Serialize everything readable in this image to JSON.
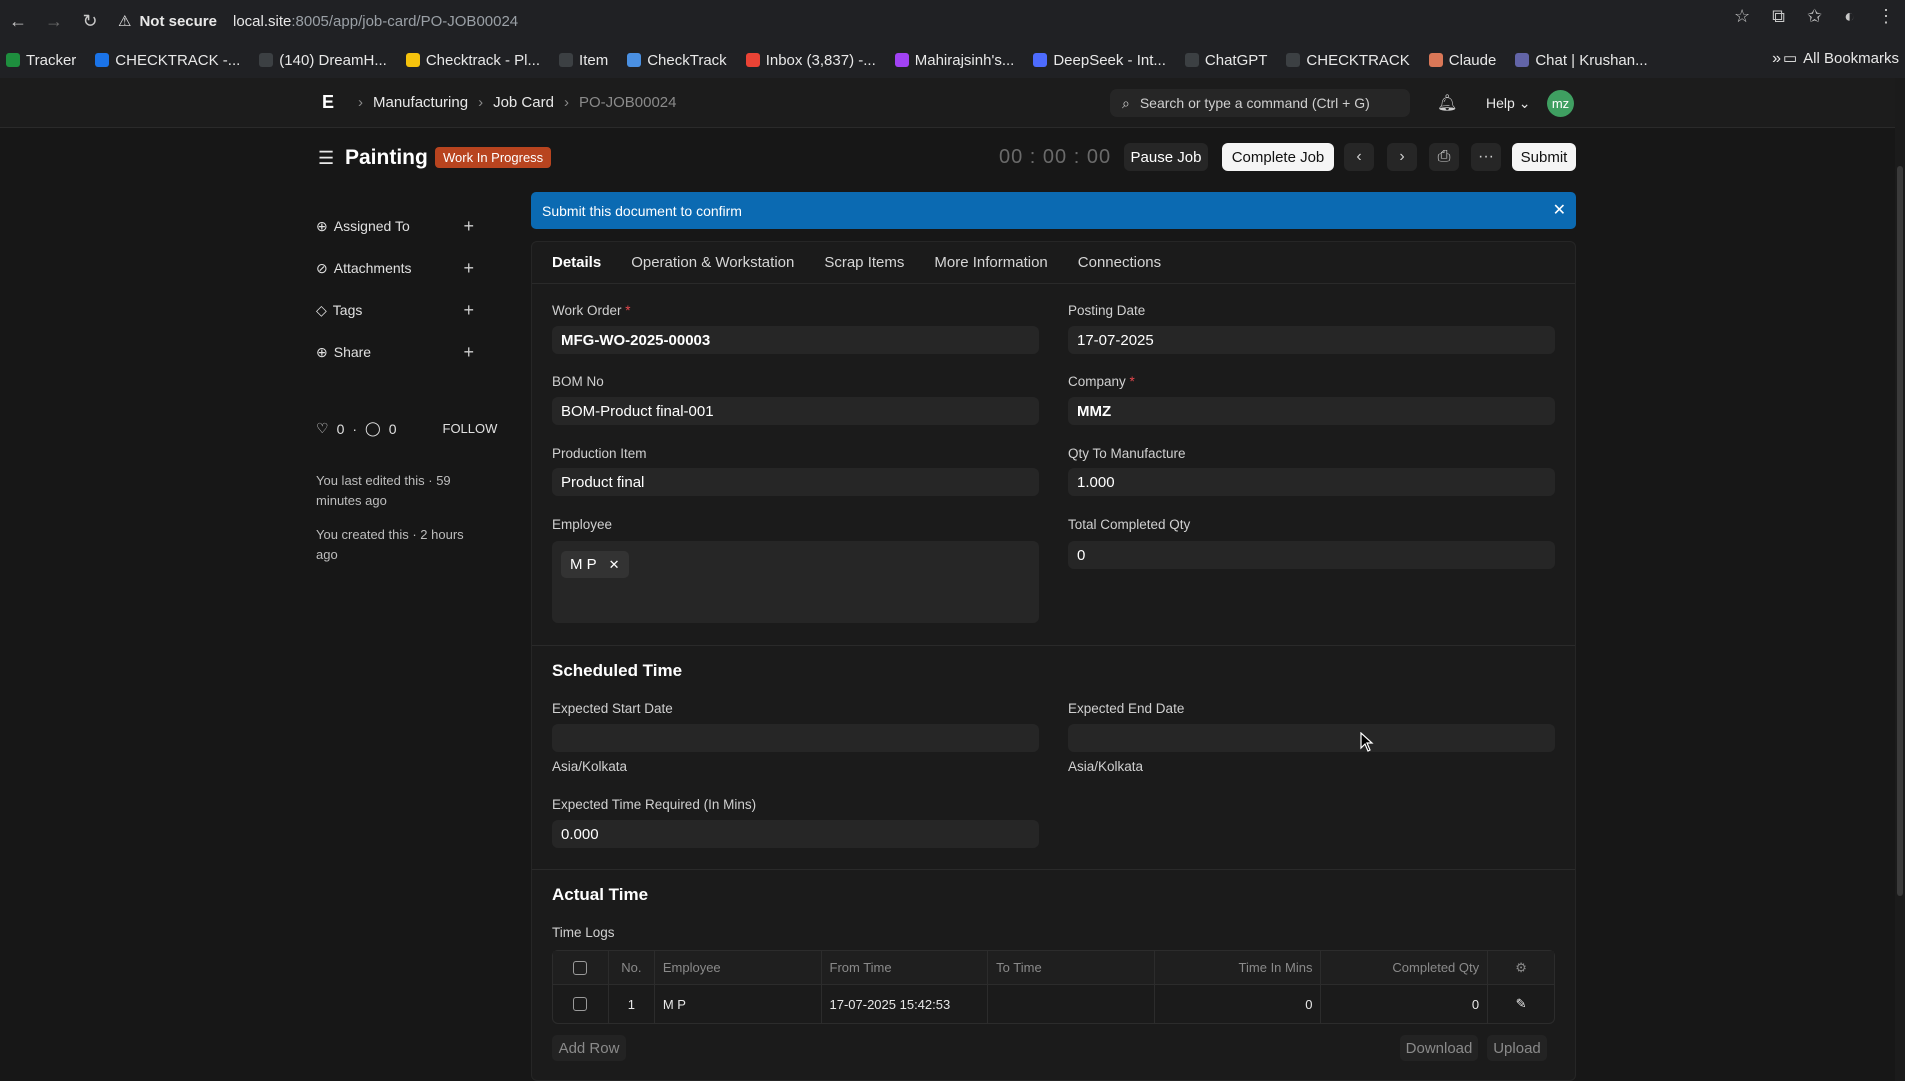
{
  "browser": {
    "warning": "Not secure",
    "url_host": "local.site",
    "url_path": ":8005/app/job-card/PO-JOB00024",
    "bookmarks": [
      {
        "label": "Tracker",
        "color": "#1e8e3e"
      },
      {
        "label": "CHECKTRACK -...",
        "color": "#1a73e8"
      },
      {
        "label": "(140) DreamH...",
        "color": "#3c4043"
      },
      {
        "label": "Checktrack - Pl...",
        "color": "#f4c20d"
      },
      {
        "label": "Item",
        "color": "#3c4043"
      },
      {
        "label": "CheckTrack",
        "color": "#4a90e2"
      },
      {
        "label": "Inbox (3,837) -...",
        "color": "#ea4335"
      },
      {
        "label": "Mahirajsinh's...",
        "color": "#a142f4"
      },
      {
        "label": "DeepSeek - Int...",
        "color": "#4d6bfe"
      },
      {
        "label": "ChatGPT",
        "color": "#3c4043"
      },
      {
        "label": "CHECKTRACK",
        "color": "#3c4043"
      },
      {
        "label": "Claude",
        "color": "#d97757"
      },
      {
        "label": "Chat | Krushan...",
        "color": "#6264a7"
      }
    ],
    "all_bookmarks": "All Bookmarks"
  },
  "nav": {
    "logo": "E",
    "breadcrumbs": [
      "Manufacturing",
      "Job Card",
      "PO-JOB00024"
    ],
    "search_placeholder": "Search or type a command (Ctrl + G)",
    "help": "Help",
    "avatar": "mz"
  },
  "header": {
    "title": "Painting",
    "status": "Work In Progress",
    "timer": "00 : 00 : 00",
    "pause": "Pause Job",
    "complete": "Complete Job",
    "more": "···",
    "submit": "Submit"
  },
  "sidebar": {
    "items": [
      "Assigned To",
      "Attachments",
      "Tags",
      "Share"
    ],
    "likes": "0",
    "comments": "0",
    "follow": "FOLLOW",
    "edited": "You last edited this · 59 minutes ago",
    "created": "You created this · 2 hours ago"
  },
  "banner": {
    "text": "Submit this document to confirm"
  },
  "tabs": [
    "Details",
    "Operation & Workstation",
    "Scrap Items",
    "More Information",
    "Connections"
  ],
  "fields": {
    "work_order_label": "Work Order",
    "work_order": "MFG-WO-2025-00003",
    "posting_date_label": "Posting Date",
    "posting_date": "17-07-2025",
    "bom_label": "BOM No",
    "bom": "BOM-Product final-001",
    "company_label": "Company",
    "company": "MMZ",
    "production_item_label": "Production Item",
    "production_item": "Product final",
    "qty_label": "Qty To Manufacture",
    "qty": "1.000",
    "employee_label": "Employee",
    "employee": "M P",
    "completed_label": "Total Completed Qty",
    "completed": "0"
  },
  "scheduled": {
    "title": "Scheduled Time",
    "start_label": "Expected Start Date",
    "end_label": "Expected End Date",
    "tz": "Asia/Kolkata",
    "time_label": "Expected Time Required (In Mins)",
    "time": "0.000"
  },
  "actual": {
    "title": "Actual Time",
    "logs_label": "Time Logs",
    "columns": [
      "No.",
      "Employee",
      "From Time",
      "To Time",
      "Time In Mins",
      "Completed Qty"
    ],
    "rows": [
      {
        "no": "1",
        "employee": "M P",
        "from": "17-07-2025 15:42:53",
        "to": "",
        "mins": "0",
        "qty": "0"
      }
    ],
    "add_row": "Add Row",
    "download": "Download",
    "upload": "Upload"
  }
}
